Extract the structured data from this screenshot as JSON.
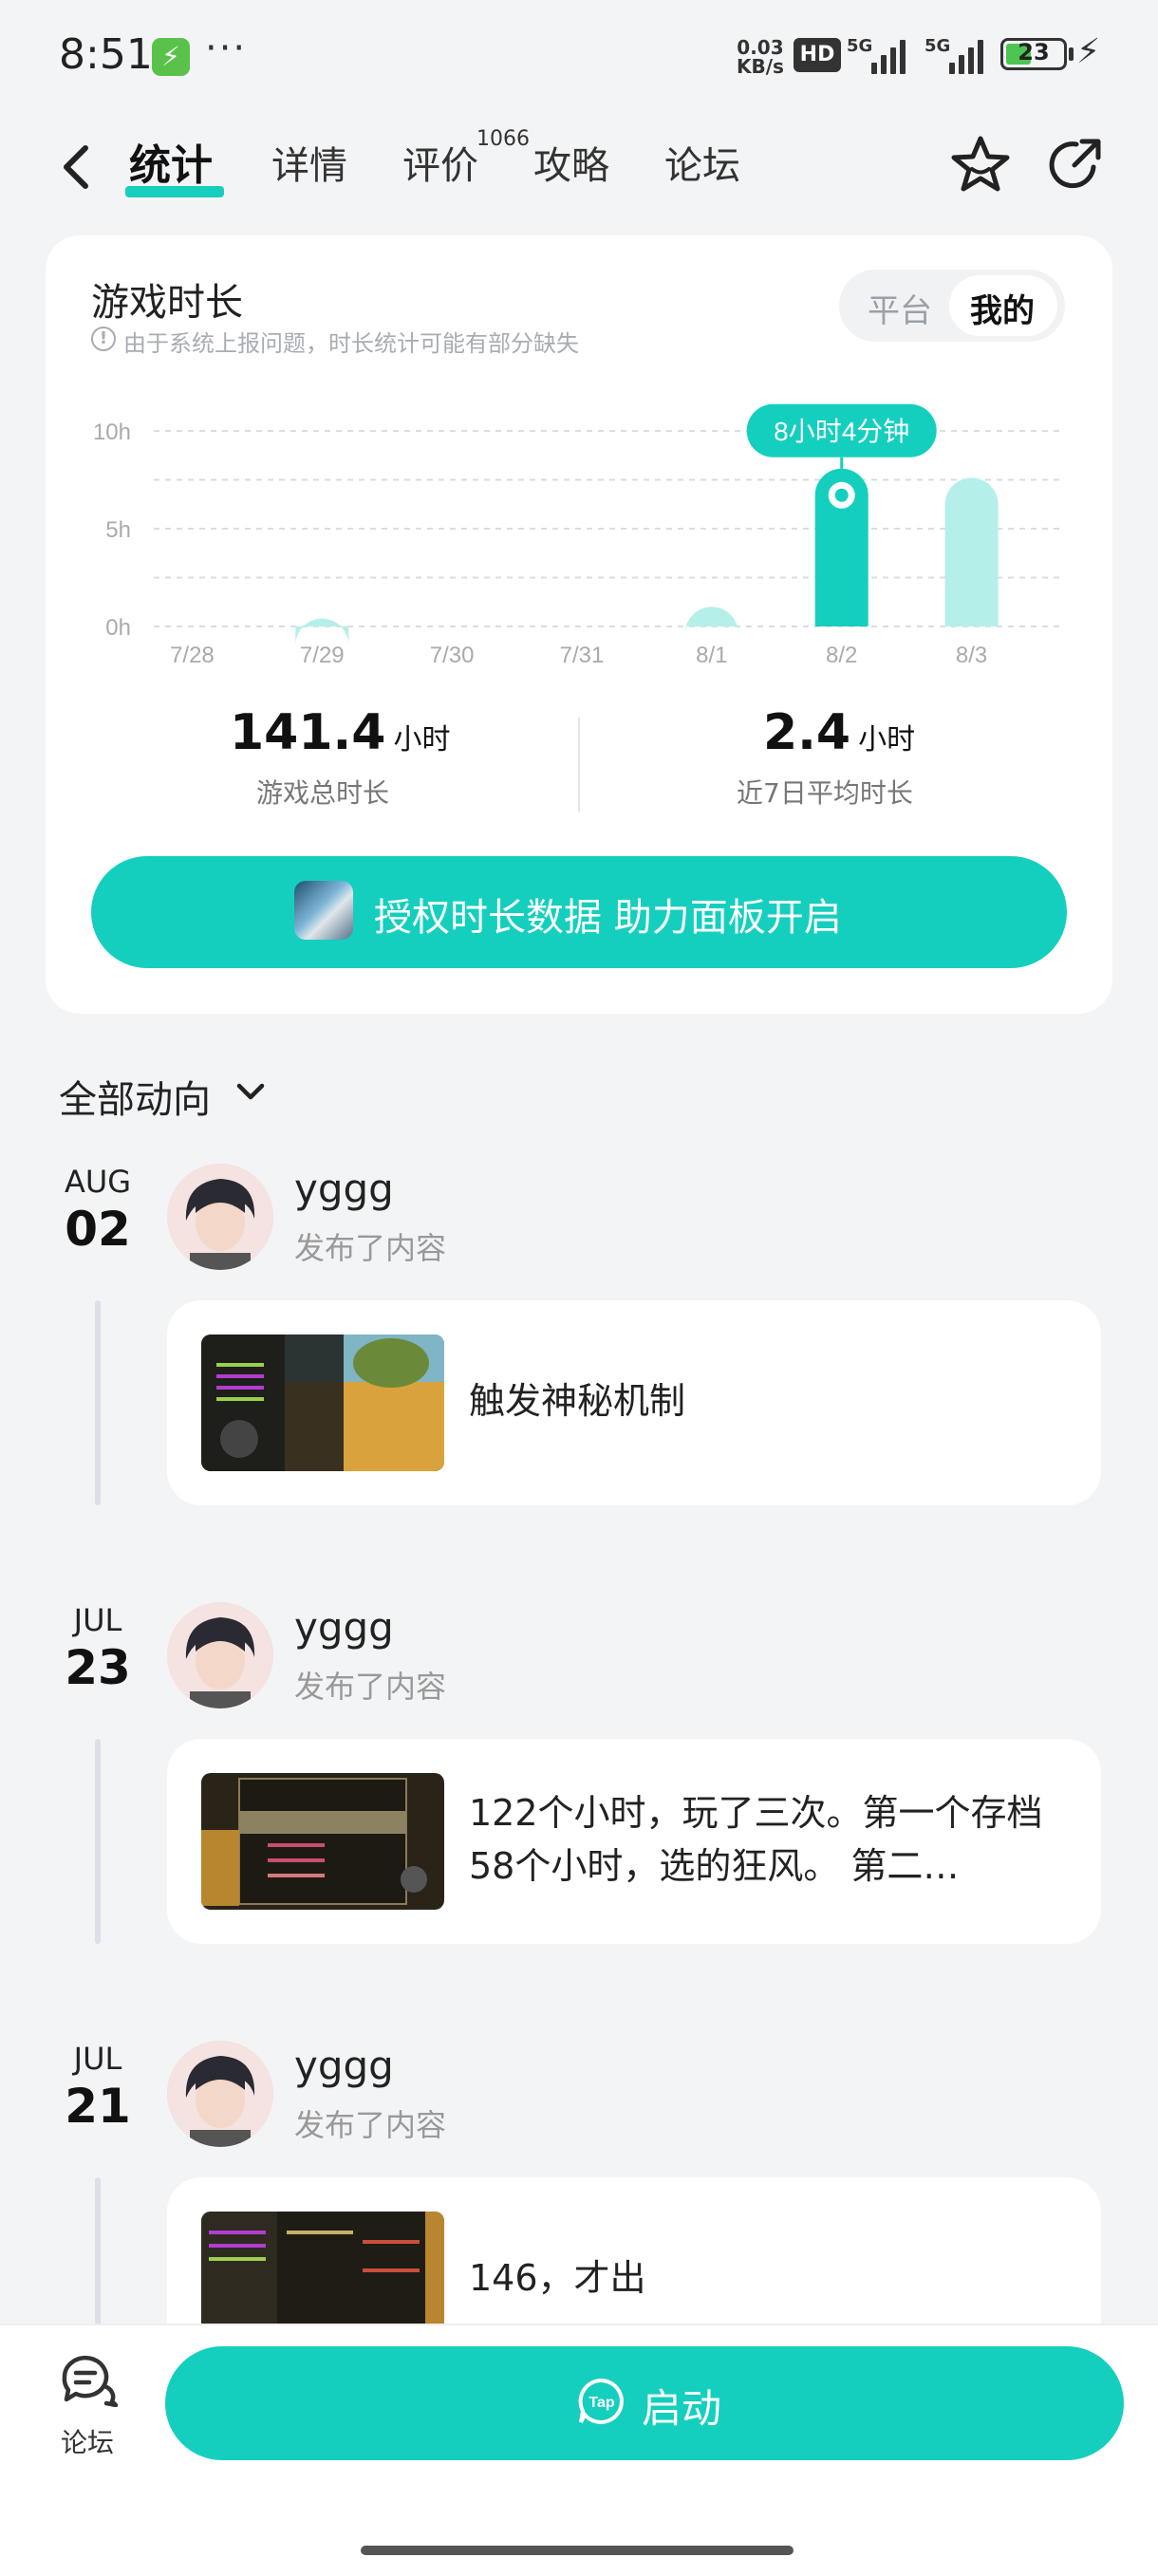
{
  "status_bar": {
    "time": "8:51",
    "more": "···",
    "net_speed_value": "0.03",
    "net_speed_unit": "KB/s",
    "hd": "HD",
    "signal1": "5G",
    "signal2": "5G",
    "battery": "23"
  },
  "nav": {
    "tabs": [
      "统计",
      "详情",
      "评价",
      "攻略",
      "论坛"
    ],
    "review_count": "1066"
  },
  "stats_card": {
    "title": "游戏时长",
    "note": "由于系统上报问题，时长统计可能有部分缺失",
    "segment": [
      "平台",
      "我的"
    ],
    "total_value": "141.4",
    "total_unit": "小时",
    "total_label": "游戏总时长",
    "avg_value": "2.4",
    "avg_unit": "小时",
    "avg_label": "近7日平均时长",
    "auth_button": "授权时长数据 助力面板开启"
  },
  "chart_data": {
    "type": "bar",
    "categories": [
      "7/28",
      "7/29",
      "7/30",
      "7/31",
      "8/1",
      "8/2",
      "8/3"
    ],
    "values": [
      0,
      0.4,
      0,
      0,
      1.0,
      8.07,
      7.6
    ],
    "y_ticks": [
      "10h",
      "5h",
      "0h"
    ],
    "ylim": [
      0,
      10
    ],
    "selected_index": 5,
    "tooltip": "8小时4分钟",
    "grid": true,
    "colors": {
      "bar": "#b4efea",
      "selected": "#14cfbe"
    }
  },
  "feed": {
    "filter": "全部动向",
    "entries": [
      {
        "month": "AUG",
        "day": "02",
        "user": "yggg",
        "action": "发布了内容",
        "text": "触发神秘机制"
      },
      {
        "month": "JUL",
        "day": "23",
        "user": "yggg",
        "action": "发布了内容",
        "text": "122个小时，玩了三次。第一个存档58个小时，选的狂风。 第二…"
      },
      {
        "month": "JUL",
        "day": "21",
        "user": "yggg",
        "action": "发布了内容",
        "text": "146，才出"
      }
    ]
  },
  "bottom": {
    "forum_label": "论坛",
    "launch_label": "启动",
    "launch_icon_text": "Tap"
  },
  "colors": {
    "accent": "#14cfbe",
    "background": "#f3f4f6"
  }
}
